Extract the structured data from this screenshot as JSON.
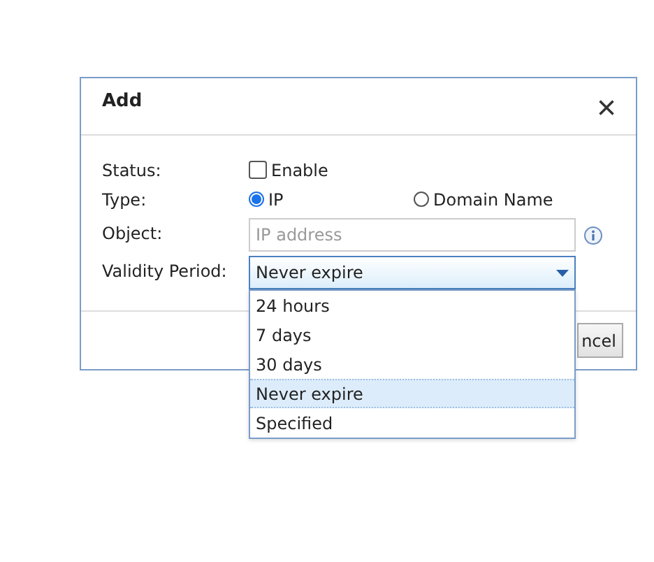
{
  "dialog": {
    "title": "Add",
    "close": "×"
  },
  "fields": [
    {
      "kind": "checkbox",
      "label": "Status:",
      "option": "Enable",
      "checked": false
    },
    {
      "kind": "radio",
      "label": "Type:",
      "options": [
        {
          "label": "IP",
          "selected": true
        },
        {
          "label": "Domain Name",
          "selected": false
        }
      ]
    },
    {
      "kind": "text",
      "label": "Object:",
      "placeholder": "IP address",
      "info": true
    },
    {
      "kind": "select",
      "label": "Validity Period:",
      "value": "Never expire",
      "expanded": true,
      "options": [
        {
          "label": "24 hours",
          "selected": false
        },
        {
          "label": "7 days",
          "selected": false
        },
        {
          "label": "30 days",
          "selected": false
        },
        {
          "label": "Never expire",
          "selected": true
        },
        {
          "label": "Specified",
          "selected": false
        }
      ]
    }
  ],
  "footer": {
    "button": "ncel"
  }
}
